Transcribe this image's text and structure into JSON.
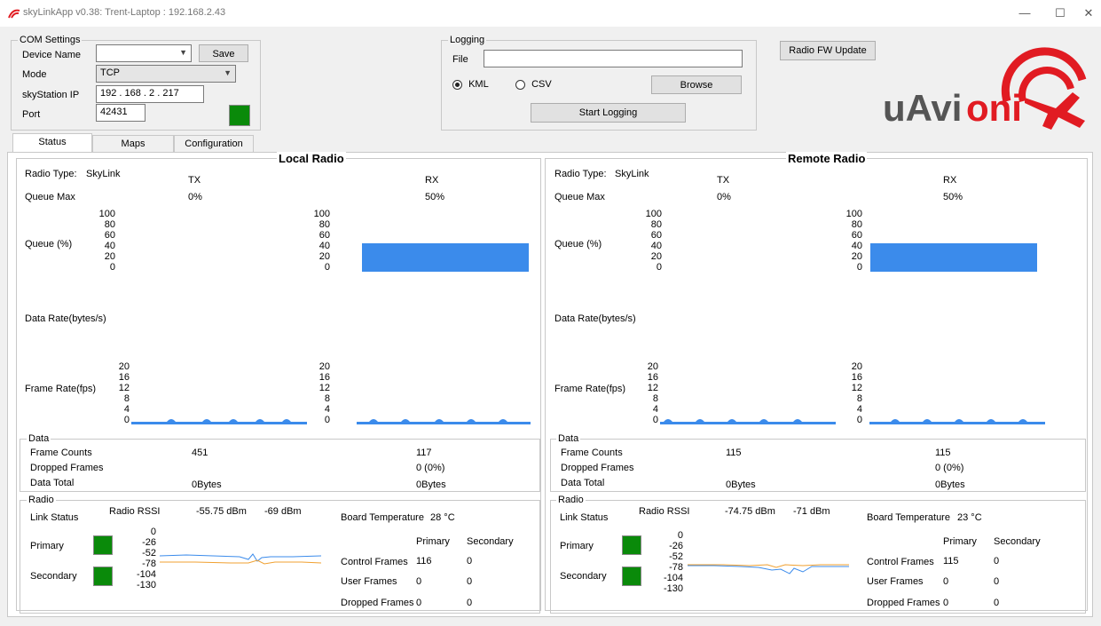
{
  "window": {
    "title": "skyLinkApp v0.38: Trent-Laptop : 192.168.2.43",
    "min": "—",
    "max": "☐",
    "close": "✕"
  },
  "com": {
    "group": "COM Settings",
    "device_name_label": "Device Name",
    "device_name_value": "",
    "save_label": "Save",
    "mode_label": "Mode",
    "mode_value": "TCP",
    "ip_label": "skyStation IP",
    "ip_value": "192 . 168 . 2 . 217",
    "port_label": "Port",
    "port_value": "42431",
    "status_color": "#0a8a0a"
  },
  "logging": {
    "group": "Logging",
    "file_label": "File",
    "file_value": "",
    "kml_label": "KML",
    "csv_label": "CSV",
    "browse_label": "Browse",
    "start_label": "Start Logging"
  },
  "radio_fw_label": "Radio FW Update",
  "logo": {
    "text": "uAvionix",
    "accent": "#e11b22"
  },
  "tabs": [
    "Status",
    "Maps",
    "Configuration"
  ],
  "local": {
    "title": "Local Radio",
    "radio_type_label": "Radio Type:",
    "radio_type": "SkyLink",
    "tx_label": "TX",
    "rx_label": "RX",
    "queue_max_label": "Queue Max",
    "tx_queue_max": "0%",
    "rx_queue_max": "50%",
    "queue_label": "Queue (%)",
    "data_rate_label": "Data Rate(bytes/s)",
    "frame_rate_label": "Frame Rate(fps)",
    "data_group": "Data",
    "frame_counts_label": "Frame Counts",
    "dropped_frames_label": "Dropped Frames",
    "data_total_label": "Data Total",
    "tx_frame_counts": "451",
    "rx_frame_counts": "117",
    "rx_dropped": "0 (0%)",
    "tx_data_total": "0Bytes",
    "rx_data_total": "0Bytes",
    "radio_group": "Radio",
    "link_status_label": "Link Status",
    "rssi_label": "Radio RSSI",
    "rssi1": "-55.75 dBm",
    "rssi2": "-69 dBm",
    "board_temp_label": "Board Temperature",
    "board_temp": "28 °C",
    "primary_label": "Primary",
    "secondary_label": "Secondary",
    "col_primary": "Primary",
    "col_secondary": "Secondary",
    "control_frames_label": "Control Frames",
    "control_primary": "116",
    "control_secondary": "0",
    "user_frames_label": "User Frames",
    "user_primary": "0",
    "user_secondary": "0",
    "dropped_frames2_label": "Dropped Frames",
    "dropped_primary": "0",
    "dropped_secondary": "0",
    "rx_queue_level": 50
  },
  "remote": {
    "title": "Remote Radio",
    "radio_type_label": "Radio Type:",
    "radio_type": "SkyLink",
    "tx_label": "TX",
    "rx_label": "RX",
    "queue_max_label": "Queue Max",
    "tx_queue_max": "0%",
    "rx_queue_max": "50%",
    "queue_label": "Queue (%)",
    "data_rate_label": "Data Rate(bytes/s)",
    "frame_rate_label": "Frame Rate(fps)",
    "data_group": "Data",
    "frame_counts_label": "Frame Counts",
    "dropped_frames_label": "Dropped Frames",
    "data_total_label": "Data Total",
    "tx_frame_counts": "115",
    "rx_frame_counts": "115",
    "rx_dropped": "0 (0%)",
    "tx_data_total": "0Bytes",
    "rx_data_total": "0Bytes",
    "radio_group": "Radio",
    "link_status_label": "Link Status",
    "rssi_label": "Radio RSSI",
    "rssi1": "-74.75 dBm",
    "rssi2": "-71 dBm",
    "board_temp_label": "Board Temperature",
    "board_temp": "23 °C",
    "primary_label": "Primary",
    "secondary_label": "Secondary",
    "col_primary": "Primary",
    "col_secondary": "Secondary",
    "control_frames_label": "Control Frames",
    "control_primary": "115",
    "control_secondary": "0",
    "user_frames_label": "User Frames",
    "user_primary": "0",
    "user_secondary": "0",
    "dropped_frames2_label": "Dropped Frames",
    "dropped_primary": "0",
    "dropped_secondary": "0",
    "rx_queue_level": 50
  },
  "queue_ticks": [
    "100",
    "80",
    "60",
    "40",
    "20",
    "0"
  ],
  "frame_ticks": [
    "20",
    "16",
    "12",
    "8",
    "4",
    "0"
  ],
  "rssi_ticks": [
    "0",
    "-26",
    "-52",
    "-78",
    "-104",
    "-130"
  ],
  "colors": {
    "bar": "#3b8beb",
    "status_green": "#0a8a0a",
    "rssi_primary": "#3b8beb",
    "rssi_secondary": "#f0a030"
  }
}
